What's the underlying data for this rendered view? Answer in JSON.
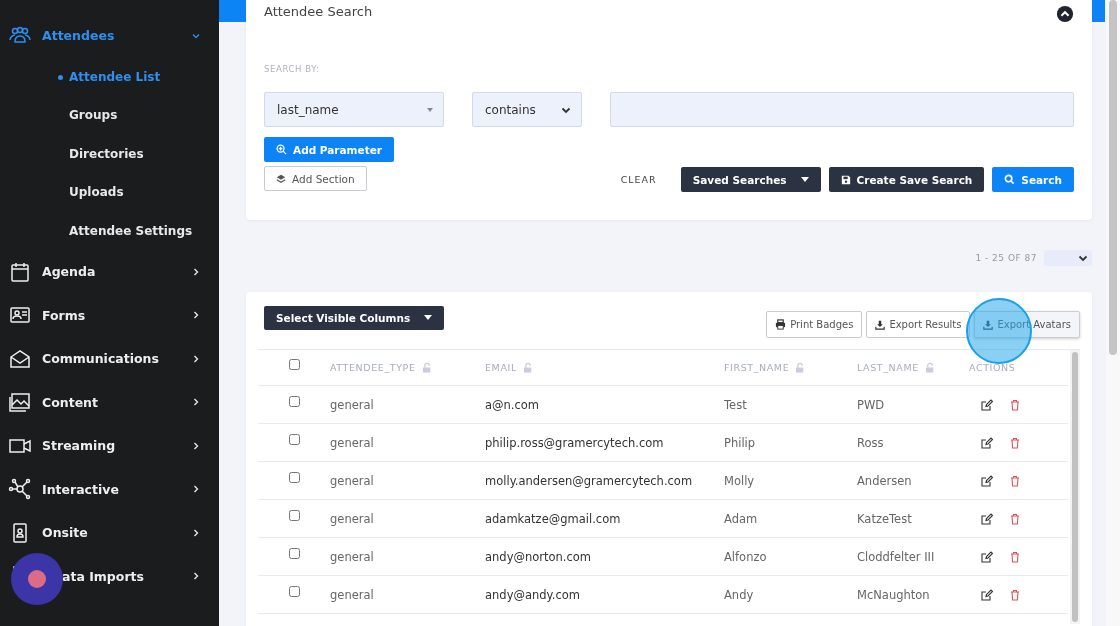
{
  "sidebar": {
    "items": [
      {
        "label": "Attendees",
        "expanded": true,
        "selected": true,
        "children": [
          {
            "label": "Attendee List",
            "selected": true
          },
          {
            "label": "Groups",
            "selected": false
          },
          {
            "label": "Directories",
            "selected": false
          },
          {
            "label": "Uploads",
            "selected": false
          },
          {
            "label": "Attendee Settings",
            "selected": false
          }
        ]
      },
      {
        "label": "Agenda",
        "expanded": false,
        "selected": false
      },
      {
        "label": "Forms",
        "expanded": false,
        "selected": false
      },
      {
        "label": "Communications",
        "expanded": false,
        "selected": false
      },
      {
        "label": "Content",
        "expanded": false,
        "selected": false
      },
      {
        "label": "Streaming",
        "expanded": false,
        "selected": false
      },
      {
        "label": "Interactive",
        "expanded": false,
        "selected": false
      },
      {
        "label": "Onsite",
        "expanded": false,
        "selected": false
      },
      {
        "label": "ata Imports",
        "expanded": false,
        "selected": false
      }
    ]
  },
  "search_panel": {
    "title": "Attendee Search",
    "search_by_label": "SEARCH BY:",
    "field_select": "last_name",
    "operator_select": "contains",
    "add_parameter": "Add Parameter",
    "add_section": "Add Section",
    "clear": "CLEAR",
    "saved_searches": "Saved Searches",
    "create_save_search": "Create Save Search",
    "search": "Search"
  },
  "pagination": {
    "range": "1 - 25 OF 87"
  },
  "results": {
    "select_columns": "Select Visible Columns",
    "print_badges": "Print Badges",
    "export_results": "Export Results",
    "export_avatars": "Export Avatars",
    "select_all_checked": false,
    "columns": [
      "ATTENDEE_TYPE",
      "EMAIL",
      "FIRST_NAME",
      "LAST_NAME"
    ],
    "actions_label": "ACTIONS",
    "rows": [
      {
        "checked": false,
        "type": "general",
        "email": "a@n.com",
        "first": "Test",
        "last": "PWD"
      },
      {
        "checked": false,
        "type": "general",
        "email": "philip.ross@gramercytech.com",
        "first": "Philip",
        "last": "Ross"
      },
      {
        "checked": false,
        "type": "general",
        "email": "molly.andersen@gramercytech.com",
        "first": "Molly",
        "last": "Andersen"
      },
      {
        "checked": false,
        "type": "general",
        "email": "adamkatze@gmail.com",
        "first": "Adam",
        "last": "KatzeTest"
      },
      {
        "checked": false,
        "type": "general",
        "email": "andy@norton.com",
        "first": "Alfonzo",
        "last": "Cloddfelter III"
      },
      {
        "checked": false,
        "type": "general",
        "email": "andy@andy.com",
        "first": "Andy",
        "last": "McNaughton"
      }
    ]
  }
}
